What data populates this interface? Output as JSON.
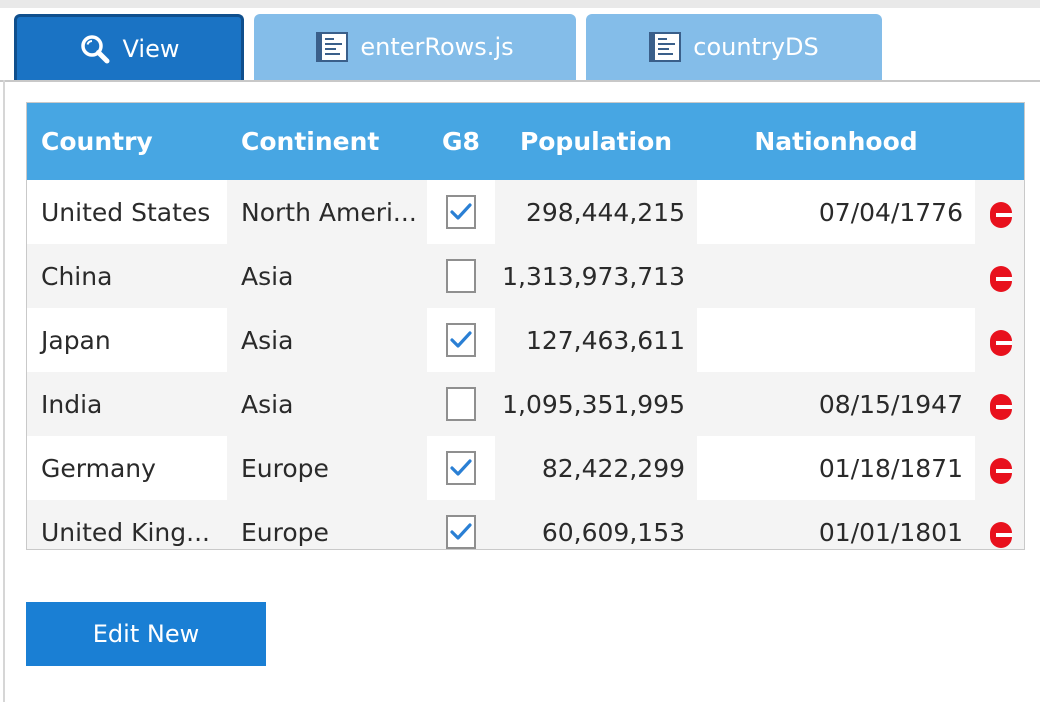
{
  "tabs": [
    {
      "label": "View",
      "icon": "magnifier-icon",
      "active": true
    },
    {
      "label": "enterRows.js",
      "icon": "document-icon",
      "active": false
    },
    {
      "label": "countryDS",
      "icon": "document-icon",
      "active": false
    }
  ],
  "grid": {
    "columns": [
      "Country",
      "Continent",
      "G8",
      "Population",
      "Nationhood"
    ],
    "rows": [
      {
        "country": "United States",
        "continent": "North Ameri...",
        "g8": true,
        "population": "298,444,215",
        "nationhood": "07/04/1776"
      },
      {
        "country": "China",
        "continent": "Asia",
        "g8": false,
        "population": "1,313,973,713",
        "nationhood": ""
      },
      {
        "country": "Japan",
        "continent": "Asia",
        "g8": true,
        "population": "127,463,611",
        "nationhood": ""
      },
      {
        "country": "India",
        "continent": "Asia",
        "g8": false,
        "population": "1,095,351,995",
        "nationhood": "08/15/1947"
      },
      {
        "country": "Germany",
        "continent": "Europe",
        "g8": true,
        "population": "82,422,299",
        "nationhood": "01/18/1871"
      },
      {
        "country": "United King...",
        "continent": "Europe",
        "g8": true,
        "population": "60,609,153",
        "nationhood": "01/01/1801"
      }
    ]
  },
  "actions": {
    "edit_new_label": "Edit New"
  },
  "colors": {
    "header": "#47a6e3",
    "active_tab": "#1a73c4",
    "inactive_tab": "#84bde9",
    "button": "#1a7fd4",
    "delete": "#e8111d",
    "checkmark": "#2a7fd4"
  }
}
